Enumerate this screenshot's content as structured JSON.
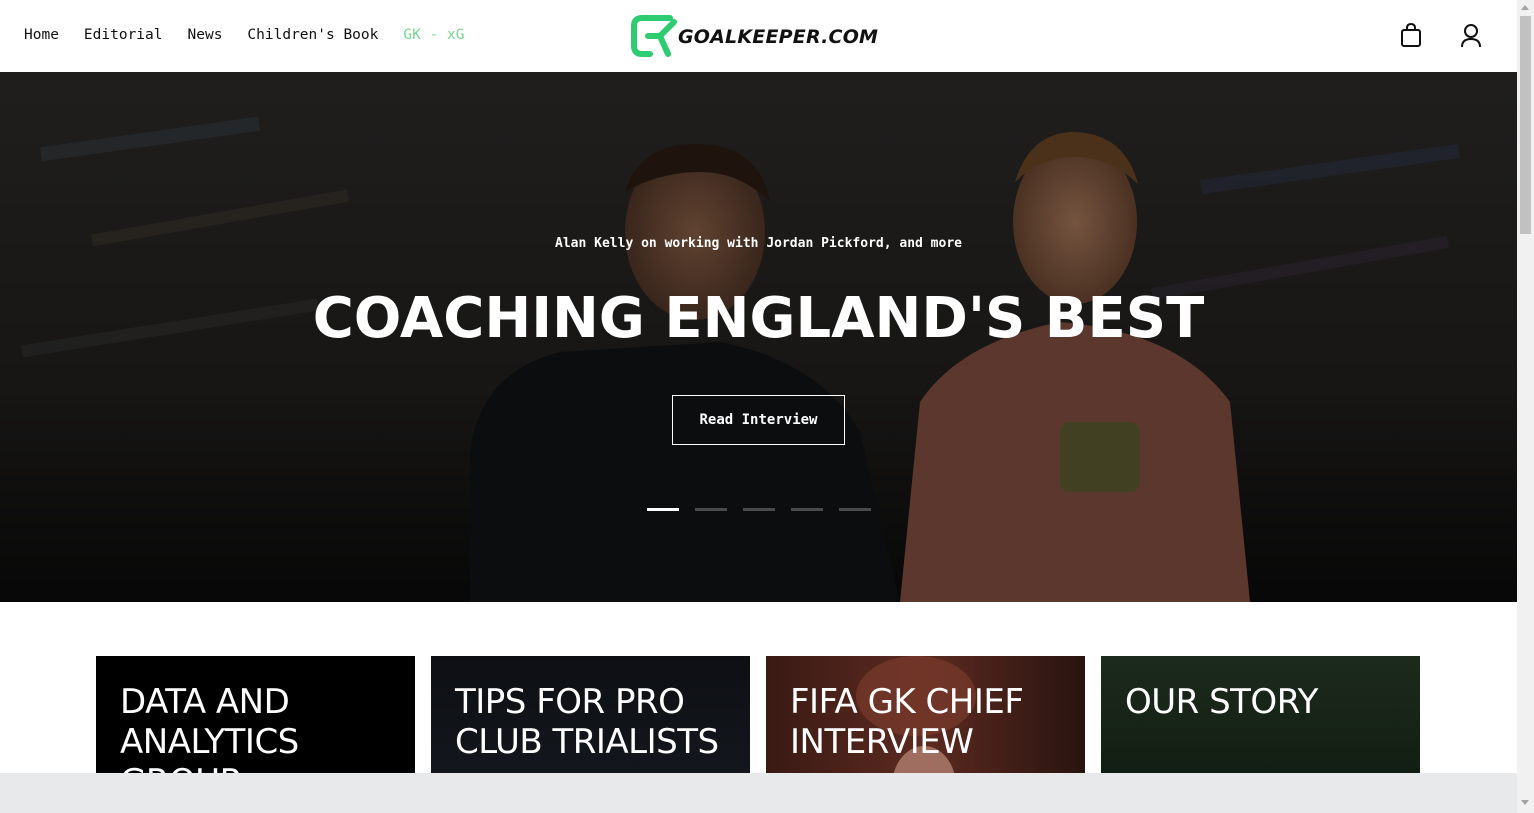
{
  "nav": {
    "items": [
      {
        "label": "Home"
      },
      {
        "label": "Editorial"
      },
      {
        "label": "News"
      },
      {
        "label": "Children's Book"
      },
      {
        "label": "GK - xG"
      }
    ]
  },
  "logo": {
    "text": "GOALKEEPER.COM",
    "accent_color": "#2ecc71"
  },
  "header_icons": {
    "cart": "shopping-bag-icon",
    "account": "user-icon"
  },
  "hero": {
    "kicker": "Alan Kelly on working with Jordan Pickford, and more",
    "title": "COACHING ENGLAND'S BEST",
    "button_label": "Read Interview",
    "slide_count": 5,
    "active_slide": 1
  },
  "cards": [
    {
      "title": "DATA AND ANALYTICS GROUP"
    },
    {
      "title": "TIPS FOR PRO CLUB TRIALISTS"
    },
    {
      "title": "FIFA GK CHIEF INTERVIEW"
    },
    {
      "title": "OUR STORY"
    }
  ],
  "colors": {
    "accent": "#7ad68f",
    "text": "#111111",
    "hero_bg": "#1e1d1c"
  }
}
